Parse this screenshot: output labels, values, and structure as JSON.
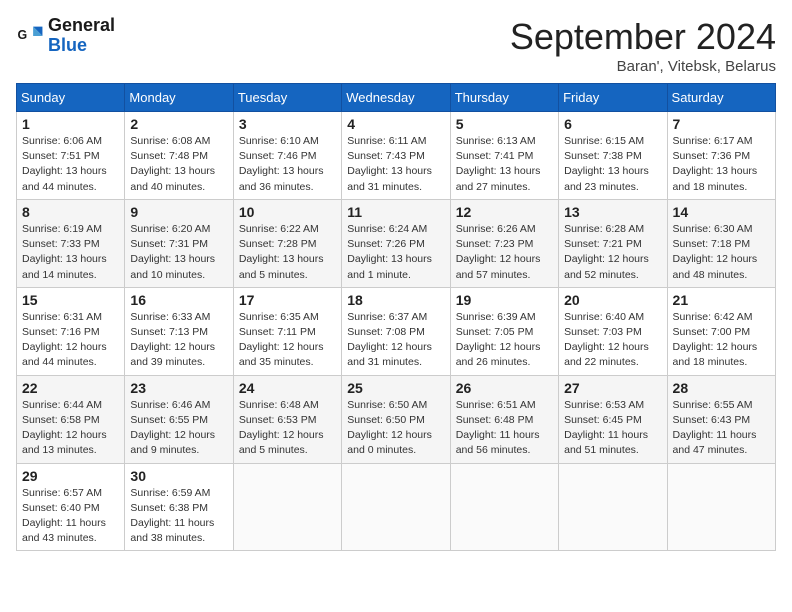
{
  "logo": {
    "line1": "General",
    "line2": "Blue"
  },
  "title": "September 2024",
  "subtitle": "Baran', Vitebsk, Belarus",
  "days_of_week": [
    "Sunday",
    "Monday",
    "Tuesday",
    "Wednesday",
    "Thursday",
    "Friday",
    "Saturday"
  ],
  "weeks": [
    [
      {
        "day": "1",
        "info": "Sunrise: 6:06 AM\nSunset: 7:51 PM\nDaylight: 13 hours\nand 44 minutes."
      },
      {
        "day": "2",
        "info": "Sunrise: 6:08 AM\nSunset: 7:48 PM\nDaylight: 13 hours\nand 40 minutes."
      },
      {
        "day": "3",
        "info": "Sunrise: 6:10 AM\nSunset: 7:46 PM\nDaylight: 13 hours\nand 36 minutes."
      },
      {
        "day": "4",
        "info": "Sunrise: 6:11 AM\nSunset: 7:43 PM\nDaylight: 13 hours\nand 31 minutes."
      },
      {
        "day": "5",
        "info": "Sunrise: 6:13 AM\nSunset: 7:41 PM\nDaylight: 13 hours\nand 27 minutes."
      },
      {
        "day": "6",
        "info": "Sunrise: 6:15 AM\nSunset: 7:38 PM\nDaylight: 13 hours\nand 23 minutes."
      },
      {
        "day": "7",
        "info": "Sunrise: 6:17 AM\nSunset: 7:36 PM\nDaylight: 13 hours\nand 18 minutes."
      }
    ],
    [
      {
        "day": "8",
        "info": "Sunrise: 6:19 AM\nSunset: 7:33 PM\nDaylight: 13 hours\nand 14 minutes."
      },
      {
        "day": "9",
        "info": "Sunrise: 6:20 AM\nSunset: 7:31 PM\nDaylight: 13 hours\nand 10 minutes."
      },
      {
        "day": "10",
        "info": "Sunrise: 6:22 AM\nSunset: 7:28 PM\nDaylight: 13 hours\nand 5 minutes."
      },
      {
        "day": "11",
        "info": "Sunrise: 6:24 AM\nSunset: 7:26 PM\nDaylight: 13 hours\nand 1 minute."
      },
      {
        "day": "12",
        "info": "Sunrise: 6:26 AM\nSunset: 7:23 PM\nDaylight: 12 hours\nand 57 minutes."
      },
      {
        "day": "13",
        "info": "Sunrise: 6:28 AM\nSunset: 7:21 PM\nDaylight: 12 hours\nand 52 minutes."
      },
      {
        "day": "14",
        "info": "Sunrise: 6:30 AM\nSunset: 7:18 PM\nDaylight: 12 hours\nand 48 minutes."
      }
    ],
    [
      {
        "day": "15",
        "info": "Sunrise: 6:31 AM\nSunset: 7:16 PM\nDaylight: 12 hours\nand 44 minutes."
      },
      {
        "day": "16",
        "info": "Sunrise: 6:33 AM\nSunset: 7:13 PM\nDaylight: 12 hours\nand 39 minutes."
      },
      {
        "day": "17",
        "info": "Sunrise: 6:35 AM\nSunset: 7:11 PM\nDaylight: 12 hours\nand 35 minutes."
      },
      {
        "day": "18",
        "info": "Sunrise: 6:37 AM\nSunset: 7:08 PM\nDaylight: 12 hours\nand 31 minutes."
      },
      {
        "day": "19",
        "info": "Sunrise: 6:39 AM\nSunset: 7:05 PM\nDaylight: 12 hours\nand 26 minutes."
      },
      {
        "day": "20",
        "info": "Sunrise: 6:40 AM\nSunset: 7:03 PM\nDaylight: 12 hours\nand 22 minutes."
      },
      {
        "day": "21",
        "info": "Sunrise: 6:42 AM\nSunset: 7:00 PM\nDaylight: 12 hours\nand 18 minutes."
      }
    ],
    [
      {
        "day": "22",
        "info": "Sunrise: 6:44 AM\nSunset: 6:58 PM\nDaylight: 12 hours\nand 13 minutes."
      },
      {
        "day": "23",
        "info": "Sunrise: 6:46 AM\nSunset: 6:55 PM\nDaylight: 12 hours\nand 9 minutes."
      },
      {
        "day": "24",
        "info": "Sunrise: 6:48 AM\nSunset: 6:53 PM\nDaylight: 12 hours\nand 5 minutes."
      },
      {
        "day": "25",
        "info": "Sunrise: 6:50 AM\nSunset: 6:50 PM\nDaylight: 12 hours\nand 0 minutes."
      },
      {
        "day": "26",
        "info": "Sunrise: 6:51 AM\nSunset: 6:48 PM\nDaylight: 11 hours\nand 56 minutes."
      },
      {
        "day": "27",
        "info": "Sunrise: 6:53 AM\nSunset: 6:45 PM\nDaylight: 11 hours\nand 51 minutes."
      },
      {
        "day": "28",
        "info": "Sunrise: 6:55 AM\nSunset: 6:43 PM\nDaylight: 11 hours\nand 47 minutes."
      }
    ],
    [
      {
        "day": "29",
        "info": "Sunrise: 6:57 AM\nSunset: 6:40 PM\nDaylight: 11 hours\nand 43 minutes."
      },
      {
        "day": "30",
        "info": "Sunrise: 6:59 AM\nSunset: 6:38 PM\nDaylight: 11 hours\nand 38 minutes."
      },
      {
        "day": "",
        "info": ""
      },
      {
        "day": "",
        "info": ""
      },
      {
        "day": "",
        "info": ""
      },
      {
        "day": "",
        "info": ""
      },
      {
        "day": "",
        "info": ""
      }
    ]
  ]
}
